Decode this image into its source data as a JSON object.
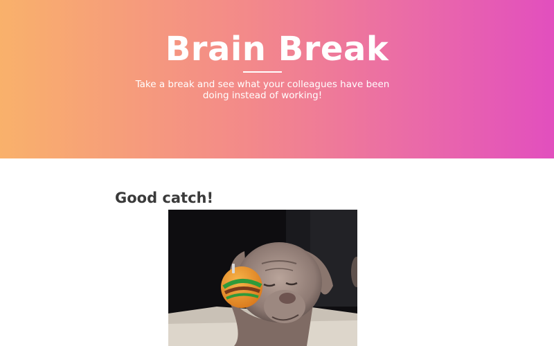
{
  "hero": {
    "title": "Brain Break",
    "subtitle": "Take a break and see what your colleagues have been doing instead of working!"
  },
  "post": {
    "title": "Good catch!"
  },
  "colors": {
    "gradient_start": "#f9b16b",
    "gradient_end": "#e24fbe",
    "heading_text": "#3a3a3a"
  }
}
